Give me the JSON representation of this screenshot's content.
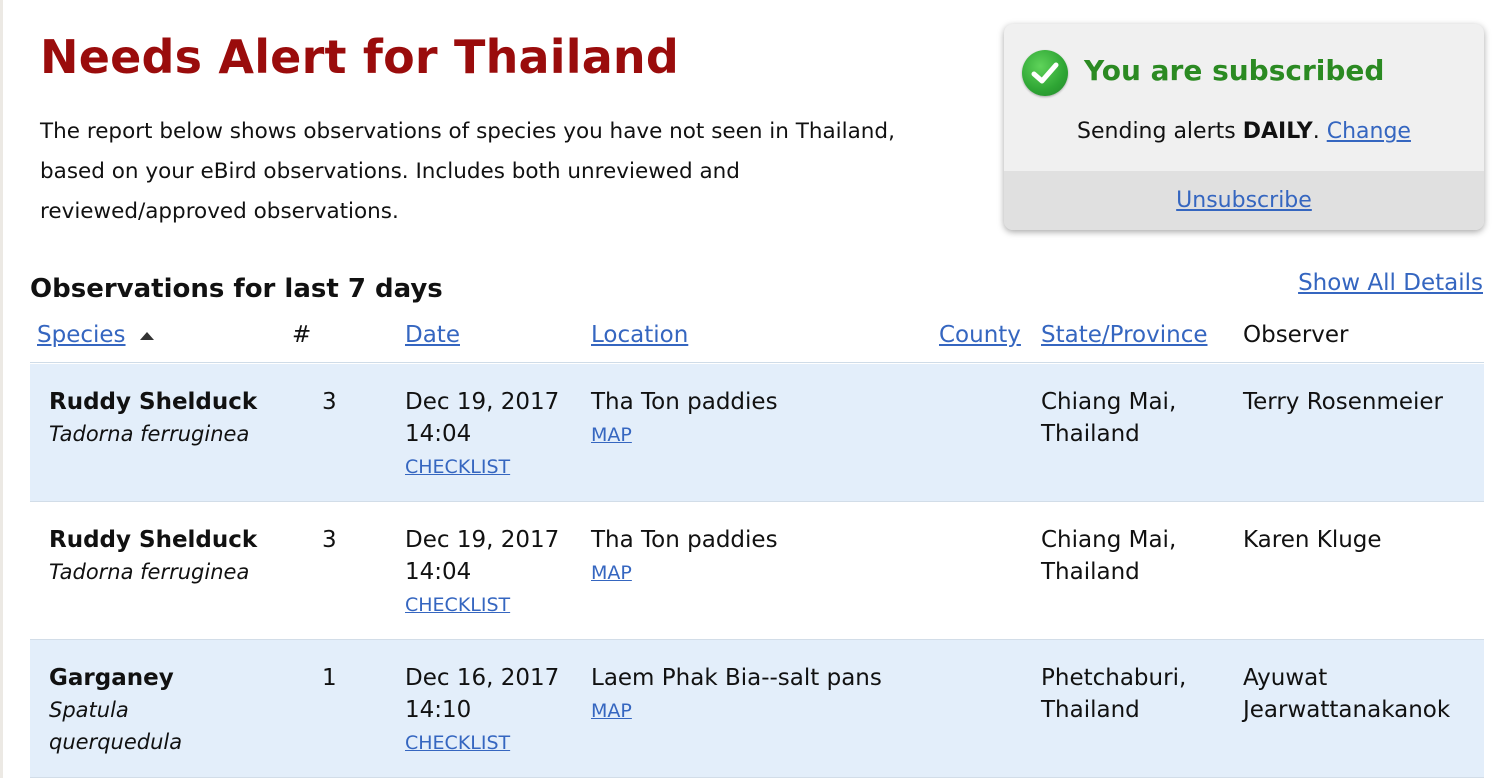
{
  "page": {
    "title": "Needs Alert for Thailand",
    "intro": "The report below shows observations of species you have not seen in Thailand, based on your eBird observations. Includes both unreviewed and reviewed/approved observations."
  },
  "subscription": {
    "status": "You are subscribed",
    "sending_prefix": "Sending alerts",
    "frequency": "DAILY",
    "sending_suffix": ".",
    "change_label": "Change",
    "unsubscribe_label": "Unsubscribe",
    "status_color": "#2b8a22",
    "icon": "check-circle-icon"
  },
  "section": {
    "title": "Observations for last 7 days",
    "show_all_label": "Show All Details"
  },
  "table": {
    "headers": {
      "species": "Species",
      "count": "#",
      "date": "Date",
      "location": "Location",
      "county": "County",
      "state": "State/Province",
      "observer": "Observer"
    },
    "sort_indicator": "ascending",
    "rows": [
      {
        "common": "Ruddy Shelduck",
        "sci_1": "Tadorna ferruginea",
        "sci_2": "",
        "count": "3",
        "date": "Dec 19, 2017",
        "time": "14:04",
        "checklist": "CHECKLIST",
        "location": "Tha Ton paddies",
        "map": "MAP",
        "county": "",
        "state_1": "Chiang Mai,",
        "state_2": "Thailand",
        "observer_1": "Terry Rosenmeier",
        "observer_2": ""
      },
      {
        "common": "Ruddy Shelduck",
        "sci_1": "Tadorna ferruginea",
        "sci_2": "",
        "count": "3",
        "date": "Dec 19, 2017",
        "time": "14:04",
        "checklist": "CHECKLIST",
        "location": "Tha Ton paddies",
        "map": "MAP",
        "county": "",
        "state_1": "Chiang Mai,",
        "state_2": "Thailand",
        "observer_1": "Karen Kluge",
        "observer_2": ""
      },
      {
        "common": "Garganey",
        "sci_1": "Spatula",
        "sci_2": "querquedula",
        "count": "1",
        "date": "Dec 16, 2017",
        "time": "14:10",
        "checklist": "CHECKLIST",
        "location": "Laem Phak Bia--salt pans",
        "map": "MAP",
        "county": "",
        "state_1": "Phetchaburi,",
        "state_2": "Thailand",
        "observer_1": "Ayuwat",
        "observer_2": "Jearwattanakanok"
      }
    ]
  },
  "colors": {
    "title": "#9a0c0c",
    "link": "#3566c0",
    "row_shade": "#e3eefa"
  }
}
